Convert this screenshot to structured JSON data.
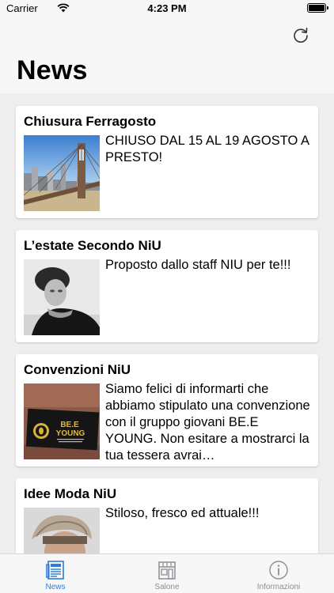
{
  "status_bar": {
    "carrier": "Carrier",
    "time": "4:23 PM"
  },
  "header": {
    "title": "News",
    "refresh_icon": "refresh-icon"
  },
  "cards": [
    {
      "title": "Chiusura Ferragosto",
      "text": "CHIUSO DAL 15 AL 19 AGOSTO A PRESTO!",
      "image": "bridge-city-photo"
    },
    {
      "title": "L’estate Secondo NiU",
      "text": "Proposto dallo staff NIU per te!!!",
      "image": "portrait-bw-photo"
    },
    {
      "title": "Convenzioni NiU",
      "text": "Siamo felici di informarti che abbiamo stipulato una convenzione con il gruppo giovani BE.E YOUNG. Non esitare a mostrarci la tua tessera avrai…",
      "image": "bee-young-card-photo"
    },
    {
      "title": "Idee Moda NiU",
      "text": "Stiloso, fresco ed attuale!!!",
      "image": "hairstyle-photo"
    }
  ],
  "bee_card": {
    "brand": "BE.E",
    "line2": "YOUNG"
  },
  "tabs": [
    {
      "label": "News",
      "icon": "newspaper-icon",
      "active": true
    },
    {
      "label": "Salone",
      "icon": "storefront-icon",
      "active": false
    },
    {
      "label": "Informazioni",
      "icon": "info-icon",
      "active": false
    }
  ],
  "colors": {
    "accent": "#2f7bd6",
    "inactive": "#8e8e93"
  }
}
